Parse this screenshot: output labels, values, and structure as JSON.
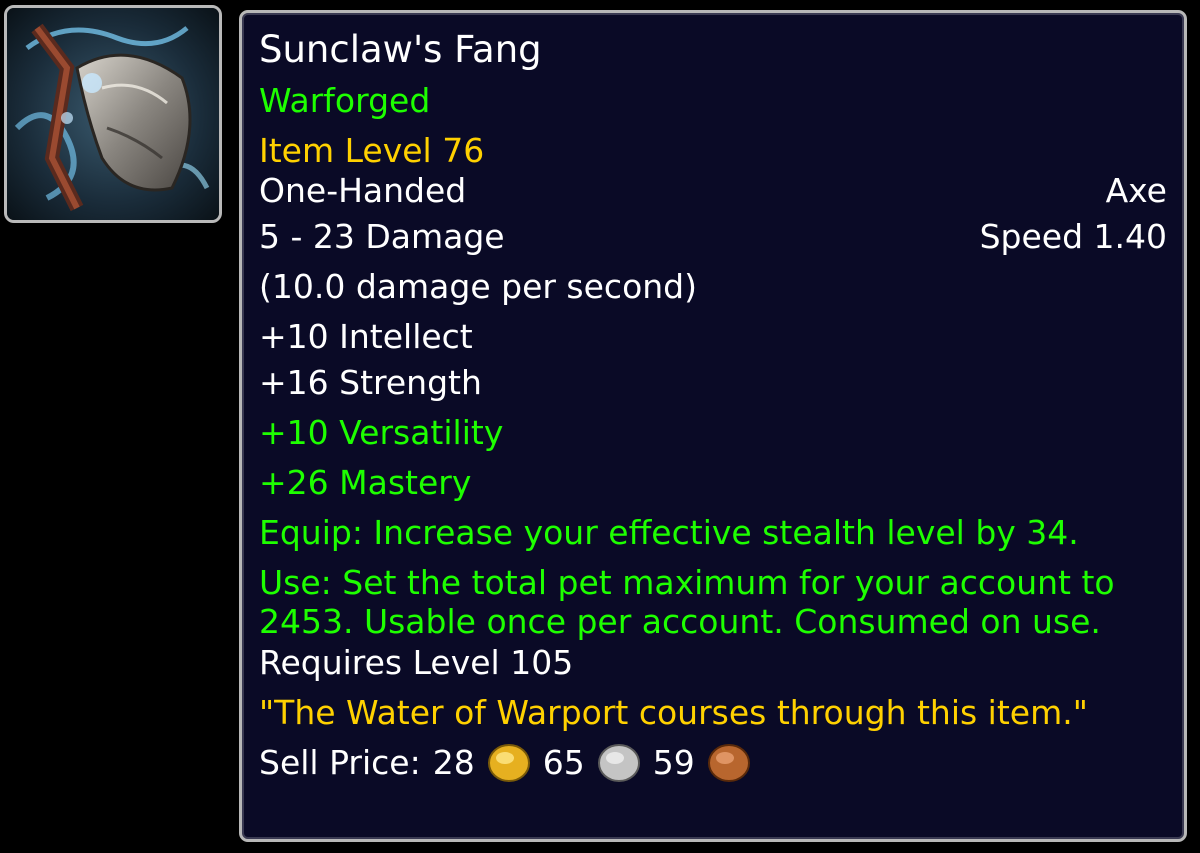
{
  "item": {
    "name": "Sunclaw's Fang",
    "quality_tag": "Warforged",
    "item_level": "Item Level 76",
    "slot": "One-Handed",
    "weapon_type": "Axe",
    "damage": "5 - 23 Damage",
    "speed": "Speed 1.40",
    "dps": "(10.0 damage per second)",
    "stats": {
      "intellect": "+10 Intellect",
      "strength": "+16 Strength",
      "versatility": "+10 Versatility",
      "mastery": "+26 Mastery"
    },
    "equip_effect": "Equip: Increase your effective stealth level by 34.",
    "use_effect": "Use: Set the total pet maximum for your account to 2453. Usable once per account. Consumed on use.",
    "requires_level": "Requires Level 105",
    "flavor_text": "\"The Water of Warport courses through this item.\"",
    "sell_price": {
      "label": "Sell Price:",
      "gold": "28",
      "silver": "65",
      "copper": "59"
    },
    "icon": "axe-weapon-icon"
  },
  "colors": {
    "tooltip_background": "#0a0a26",
    "border": "#b8b8b8",
    "white_text": "#ffffff",
    "green_text": "#1eff00",
    "gold_text": "#ffd100",
    "gold_coin": "#e6b020",
    "silver_coin": "#c4c4c4",
    "copper_coin": "#b8662e"
  }
}
